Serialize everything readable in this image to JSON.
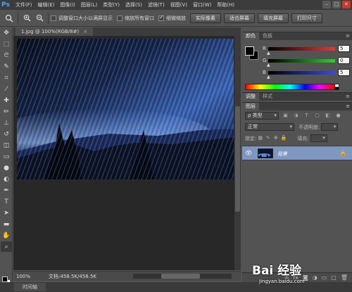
{
  "app": {
    "logo": "Ps"
  },
  "menu": [
    "文件(F)",
    "编辑(E)",
    "图像(I)",
    "图层(L)",
    "类型(Y)",
    "选择(S)",
    "滤镜(T)",
    "视图(V)",
    "窗口(W)",
    "帮助(H)"
  ],
  "window_controls": {
    "min": "–",
    "max": "□",
    "close": "✕"
  },
  "options": {
    "chk_resize": "调整窗口大小以满屏显示",
    "chk_zoom_all": "缩放所有窗口",
    "chk_scrubby": "细微缩放",
    "btn_actual": "实际像素",
    "btn_fit": "适合屏幕",
    "btn_fill": "填充屏幕",
    "btn_print": "打印尺寸",
    "checked": {
      "resize": false,
      "zoom_all": false,
      "scrubby": true
    }
  },
  "document": {
    "tab_title": "1.jpg @ 100%(RGB/8#)",
    "tab_close": "×",
    "zoom": "100%",
    "doc_info": "文档:458.5K/458.5K"
  },
  "timeline": {
    "label": "时间轴"
  },
  "color_panel": {
    "tabs": [
      "颜色",
      "色板"
    ],
    "channels": [
      {
        "label": "R",
        "value": "5",
        "color": "#e23b3b"
      },
      {
        "label": "G",
        "value": "0",
        "color": "#2fd02f"
      },
      {
        "label": "B",
        "value": "5",
        "color": "#3a4be0"
      }
    ]
  },
  "adjust_panel": {
    "tabs": [
      "调整",
      "样式"
    ]
  },
  "layers_panel": {
    "tab": "图层",
    "filter_kind": "ρ 类型",
    "blend_mode": "正常",
    "opacity_label": "不透明度:",
    "lock_label": "锁定:",
    "fill_label": "填充:",
    "layer_name": "背景"
  },
  "watermark": {
    "brand": "Bai 经验",
    "url": "jingyan.baidu.com"
  },
  "colors": {
    "accent_layer": "#7f97bf",
    "panel_bg": "#535353",
    "menu_bg": "#3c3c3c"
  }
}
